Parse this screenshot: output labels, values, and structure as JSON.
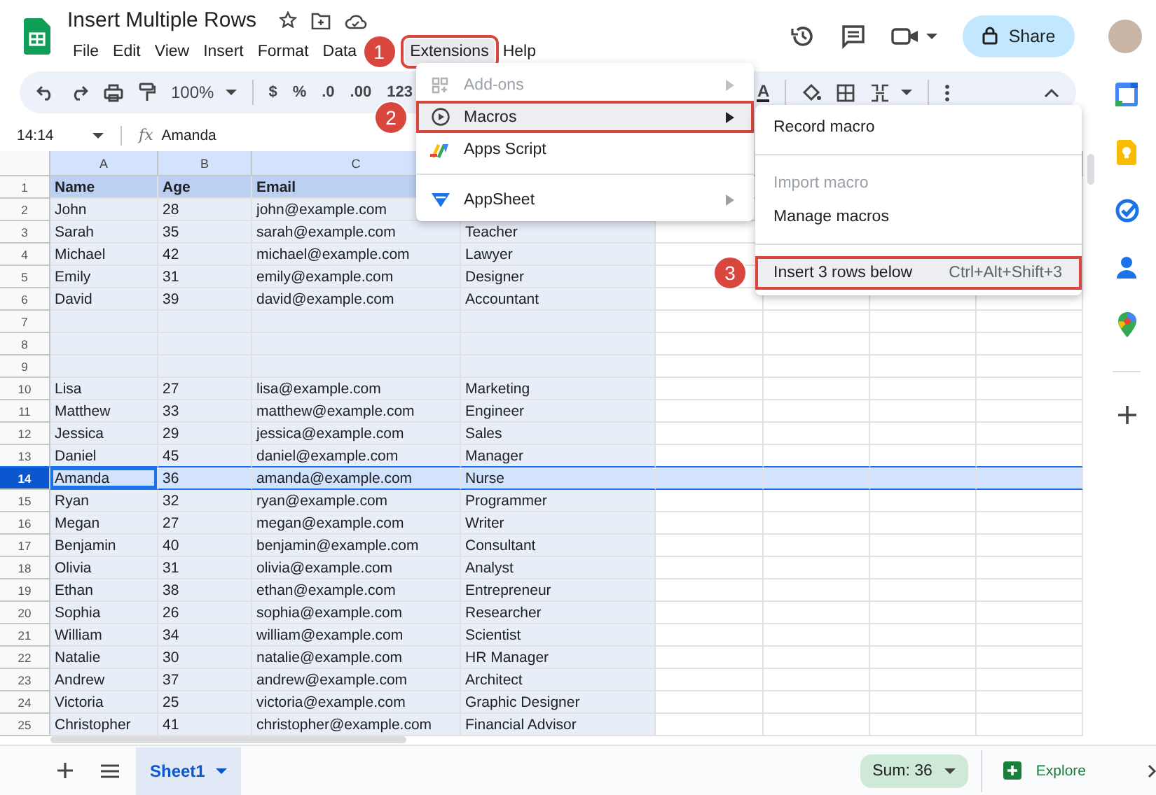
{
  "document": {
    "title": "Insert Multiple Rows"
  },
  "menubar": [
    {
      "label": "File",
      "selected": false
    },
    {
      "label": "Edit",
      "selected": false
    },
    {
      "label": "View",
      "selected": false
    },
    {
      "label": "Insert",
      "selected": false
    },
    {
      "label": "Format",
      "selected": false
    },
    {
      "label": "Data",
      "selected": false
    },
    {
      "label": "Extensions",
      "selected": true,
      "callout": "1"
    },
    {
      "label": "Help",
      "selected": false
    }
  ],
  "share_button": {
    "label": "Share"
  },
  "toolbar": {
    "zoom": "100%",
    "format_buttons": [
      "$",
      "%",
      ".0",
      ".00",
      "123"
    ],
    "text_color_label": "A"
  },
  "formula_bar": {
    "cell_reference": "14:14",
    "function_label": "fx",
    "value": "Amanda"
  },
  "column_headers": [
    "A",
    "B",
    "C"
  ],
  "rows": [
    {
      "number": "1",
      "kind": "header",
      "selected": false,
      "cells": [
        "Name",
        "Age",
        "Email"
      ]
    },
    {
      "number": "2",
      "kind": "data",
      "selected": false,
      "cells": [
        "John",
        "28",
        "john@example.com"
      ]
    },
    {
      "number": "3",
      "kind": "data",
      "selected": false,
      "cells": [
        "Sarah",
        "35",
        "sarah@example.com",
        "Teacher"
      ]
    },
    {
      "number": "4",
      "kind": "data",
      "selected": false,
      "cells": [
        "Michael",
        "42",
        "michael@example.com",
        "Lawyer"
      ]
    },
    {
      "number": "5",
      "kind": "data",
      "selected": false,
      "cells": [
        "Emily",
        "31",
        "emily@example.com",
        "Designer"
      ]
    },
    {
      "number": "6",
      "kind": "data",
      "selected": false,
      "cells": [
        "David",
        "39",
        "david@example.com",
        "Accountant"
      ]
    },
    {
      "number": "7",
      "kind": "data",
      "selected": false
    },
    {
      "number": "8",
      "kind": "data",
      "selected": false
    },
    {
      "number": "9",
      "kind": "data",
      "selected": false
    },
    {
      "number": "10",
      "kind": "data",
      "selected": false,
      "cells": [
        "Lisa",
        "27",
        "lisa@example.com",
        "Marketing"
      ]
    },
    {
      "number": "11",
      "kind": "data",
      "selected": false,
      "cells": [
        "Matthew",
        "33",
        "matthew@example.com",
        "Engineer"
      ]
    },
    {
      "number": "12",
      "kind": "data",
      "selected": false,
      "cells": [
        "Jessica",
        "29",
        "jessica@example.com",
        "Sales"
      ]
    },
    {
      "number": "13",
      "kind": "data",
      "selected": false,
      "cells": [
        "Daniel",
        "45",
        "daniel@example.com",
        "Manager"
      ]
    },
    {
      "number": "14",
      "kind": "data",
      "selected": true,
      "cells": [
        "Amanda",
        "36",
        "amanda@example.com",
        "Nurse"
      ]
    },
    {
      "number": "15",
      "kind": "data",
      "selected": false,
      "cells": [
        "Ryan",
        "32",
        "ryan@example.com",
        "Programmer"
      ]
    },
    {
      "number": "16",
      "kind": "data",
      "selected": false,
      "cells": [
        "Megan",
        "27",
        "megan@example.com",
        "Writer"
      ]
    },
    {
      "number": "17",
      "kind": "data",
      "selected": false,
      "cells": [
        "Benjamin",
        "40",
        "benjamin@example.com",
        "Consultant"
      ]
    },
    {
      "number": "18",
      "kind": "data",
      "selected": false,
      "cells": [
        "Olivia",
        "31",
        "olivia@example.com",
        "Analyst"
      ]
    },
    {
      "number": "19",
      "kind": "data",
      "selected": false,
      "cells": [
        "Ethan",
        "38",
        "ethan@example.com",
        "Entrepreneur"
      ]
    },
    {
      "number": "20",
      "kind": "data",
      "selected": false,
      "cells": [
        "Sophia",
        "26",
        "sophia@example.com",
        "Researcher"
      ]
    },
    {
      "number": "21",
      "kind": "data",
      "selected": false,
      "cells": [
        "William",
        "34",
        "william@example.com",
        "Scientist"
      ]
    },
    {
      "number": "22",
      "kind": "data",
      "selected": false,
      "cells": [
        "Natalie",
        "30",
        "natalie@example.com",
        "HR Manager"
      ]
    },
    {
      "number": "23",
      "kind": "data",
      "selected": false,
      "cells": [
        "Andrew",
        "37",
        "andrew@example.com",
        "Architect"
      ]
    },
    {
      "number": "24",
      "kind": "data",
      "selected": false,
      "cells": [
        "Victoria",
        "25",
        "victoria@example.com",
        "Graphic Designer"
      ]
    },
    {
      "number": "25",
      "kind": "data",
      "selected": false,
      "cells": [
        "Christopher",
        "41",
        "christopher@example.com",
        "Financial Advisor"
      ]
    }
  ],
  "extensions_menu": {
    "items": [
      {
        "kind": "addons",
        "label": "Add-ons",
        "disabled": true,
        "has_submenu": true,
        "selected": false
      },
      {
        "kind": "macros",
        "label": "Macros",
        "disabled": false,
        "has_submenu": true,
        "selected": true,
        "callout": "2"
      },
      {
        "kind": "apps-script",
        "label": "Apps Script",
        "disabled": false,
        "has_submenu": false,
        "selected": false
      },
      {
        "kind": "divider"
      },
      {
        "kind": "appsheet",
        "label": "AppSheet",
        "disabled": false,
        "has_submenu": true,
        "selected": false
      }
    ]
  },
  "macros_submenu": {
    "items": [
      {
        "kind": "item",
        "label": "Record macro",
        "disabled": false,
        "selected": false
      },
      {
        "kind": "divider"
      },
      {
        "kind": "item",
        "label": "Import macro",
        "disabled": true,
        "selected": false
      },
      {
        "kind": "item",
        "label": "Manage macros",
        "disabled": false,
        "selected": false
      },
      {
        "kind": "divider"
      },
      {
        "kind": "item",
        "label": "Insert 3 rows below",
        "shortcut": "Ctrl+Alt+Shift+3",
        "disabled": false,
        "selected": true,
        "callout": "3"
      }
    ]
  },
  "sheet_tabs": [
    {
      "label": "Sheet1",
      "selected": true
    }
  ],
  "status": {
    "sum": "Sum: 36",
    "explore": "Explore"
  }
}
